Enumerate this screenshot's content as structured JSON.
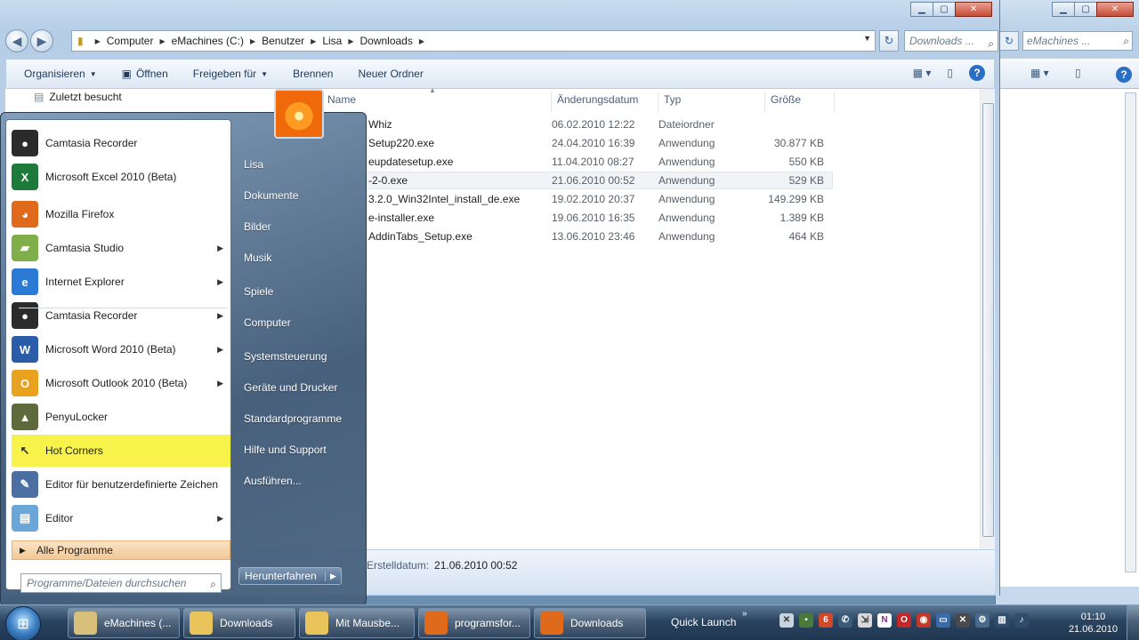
{
  "explorer": {
    "breadcrumb": [
      "Computer",
      "eMachines (C:)",
      "Benutzer",
      "Lisa",
      "Downloads"
    ],
    "search_placeholder": "Downloads ...",
    "toolbar": {
      "organize": "Organisieren",
      "open": "Öffnen",
      "share": "Freigeben für",
      "burn": "Brennen",
      "new_folder": "Neuer Ordner"
    },
    "nav_recent": "Zuletzt besucht",
    "columns": {
      "name": "Name",
      "date": "Änderungsdatum",
      "type": "Typ",
      "size": "Größe"
    },
    "files": [
      {
        "name": "Whiz",
        "date": "06.02.2010 12:22",
        "type": "Dateiordner",
        "size": ""
      },
      {
        "name": "Setup220.exe",
        "date": "24.04.2010 16:39",
        "type": "Anwendung",
        "size": "30.877 KB"
      },
      {
        "name": "eupdatesetup.exe",
        "date": "11.04.2010 08:27",
        "type": "Anwendung",
        "size": "550 KB"
      },
      {
        "name": "-2-0.exe",
        "date": "21.06.2010 00:52",
        "type": "Anwendung",
        "size": "529 KB"
      },
      {
        "name": "3.2.0_Win32Intel_install_de.exe",
        "date": "19.02.2010 20:37",
        "type": "Anwendung",
        "size": "149.299 KB"
      },
      {
        "name": "e-installer.exe",
        "date": "19.06.2010 16:35",
        "type": "Anwendung",
        "size": "1.389 KB"
      },
      {
        "name": "AddinTabs_Setup.exe",
        "date": "13.06.2010 23:46",
        "type": "Anwendung",
        "size": "464 KB"
      }
    ],
    "selected_row": 3,
    "details": {
      "label": "Erstelldatum:",
      "value": "21.06.2010 00:52"
    }
  },
  "explorer2": {
    "search_placeholder": "eMachines ..."
  },
  "startmenu": {
    "programs": [
      {
        "label": "Camtasia Recorder",
        "icon": "camtasia-recorder-icon",
        "color": "#2b2b2b",
        "glyph": "●",
        "arrow": false
      },
      {
        "label": "Microsoft Excel 2010 (Beta)",
        "icon": "excel-icon",
        "color": "#1e7a3a",
        "glyph": "X",
        "arrow": false
      },
      {
        "label": "Mozilla Firefox",
        "icon": "firefox-icon",
        "color": "#e06a1b",
        "glyph": "◕",
        "arrow": false
      },
      {
        "label": "Camtasia Studio",
        "icon": "camtasia-studio-icon",
        "color": "#7fae4a",
        "glyph": "▰",
        "arrow": true
      },
      {
        "label": "Internet Explorer",
        "icon": "internet-explorer-icon",
        "color": "#2b7ad6",
        "glyph": "e",
        "arrow": true
      },
      {
        "label": "Camtasia Recorder",
        "icon": "camtasia-recorder-icon",
        "color": "#2b2b2b",
        "glyph": "●",
        "arrow": true
      },
      {
        "label": "Microsoft Word 2010 (Beta)",
        "icon": "word-icon",
        "color": "#2a5caa",
        "glyph": "W",
        "arrow": true
      },
      {
        "label": "Microsoft Outlook 2010 (Beta)",
        "icon": "outlook-icon",
        "color": "#e8a21f",
        "glyph": "O",
        "arrow": true
      },
      {
        "label": "PenyuLocker",
        "icon": "penyulocker-icon",
        "color": "#5e6a3c",
        "glyph": "▲",
        "arrow": false
      },
      {
        "label": "Hot Corners",
        "icon": "cursor-icon",
        "color": "#f7f34a",
        "glyph": "↖",
        "arrow": false
      },
      {
        "label": "Editor für benutzerdefinierte Zeichen",
        "icon": "character-editor-icon",
        "color": "#4a6fa0",
        "glyph": "✎",
        "arrow": false
      },
      {
        "label": "Editor",
        "icon": "notepad-icon",
        "color": "#6aa7d8",
        "glyph": "▤",
        "arrow": true
      }
    ],
    "all_programs": "Alle Programme",
    "search_placeholder": "Programme/Dateien durchsuchen",
    "right": [
      "Lisa",
      "Dokumente",
      "Bilder",
      "Musik",
      "Spiele",
      "Computer",
      "Systemsteuerung",
      "Geräte und Drucker",
      "Standardprogramme",
      "Hilfe und Support",
      "Ausführen..."
    ],
    "shutdown": "Herunterfahren"
  },
  "taskbar": {
    "items": [
      {
        "label": "eMachines (...",
        "color": "#d8c07a"
      },
      {
        "label": "Downloads",
        "color": "#e8c45a"
      },
      {
        "label": "Mit Mausbe...",
        "color": "#e8c45a"
      },
      {
        "label": "programsfor...",
        "color": "#e06a1b"
      },
      {
        "label": "Downloads",
        "color": "#e06a1b"
      }
    ],
    "quick_launch": "Quick Launch",
    "time": "01:10",
    "date": "21.06.2010"
  }
}
